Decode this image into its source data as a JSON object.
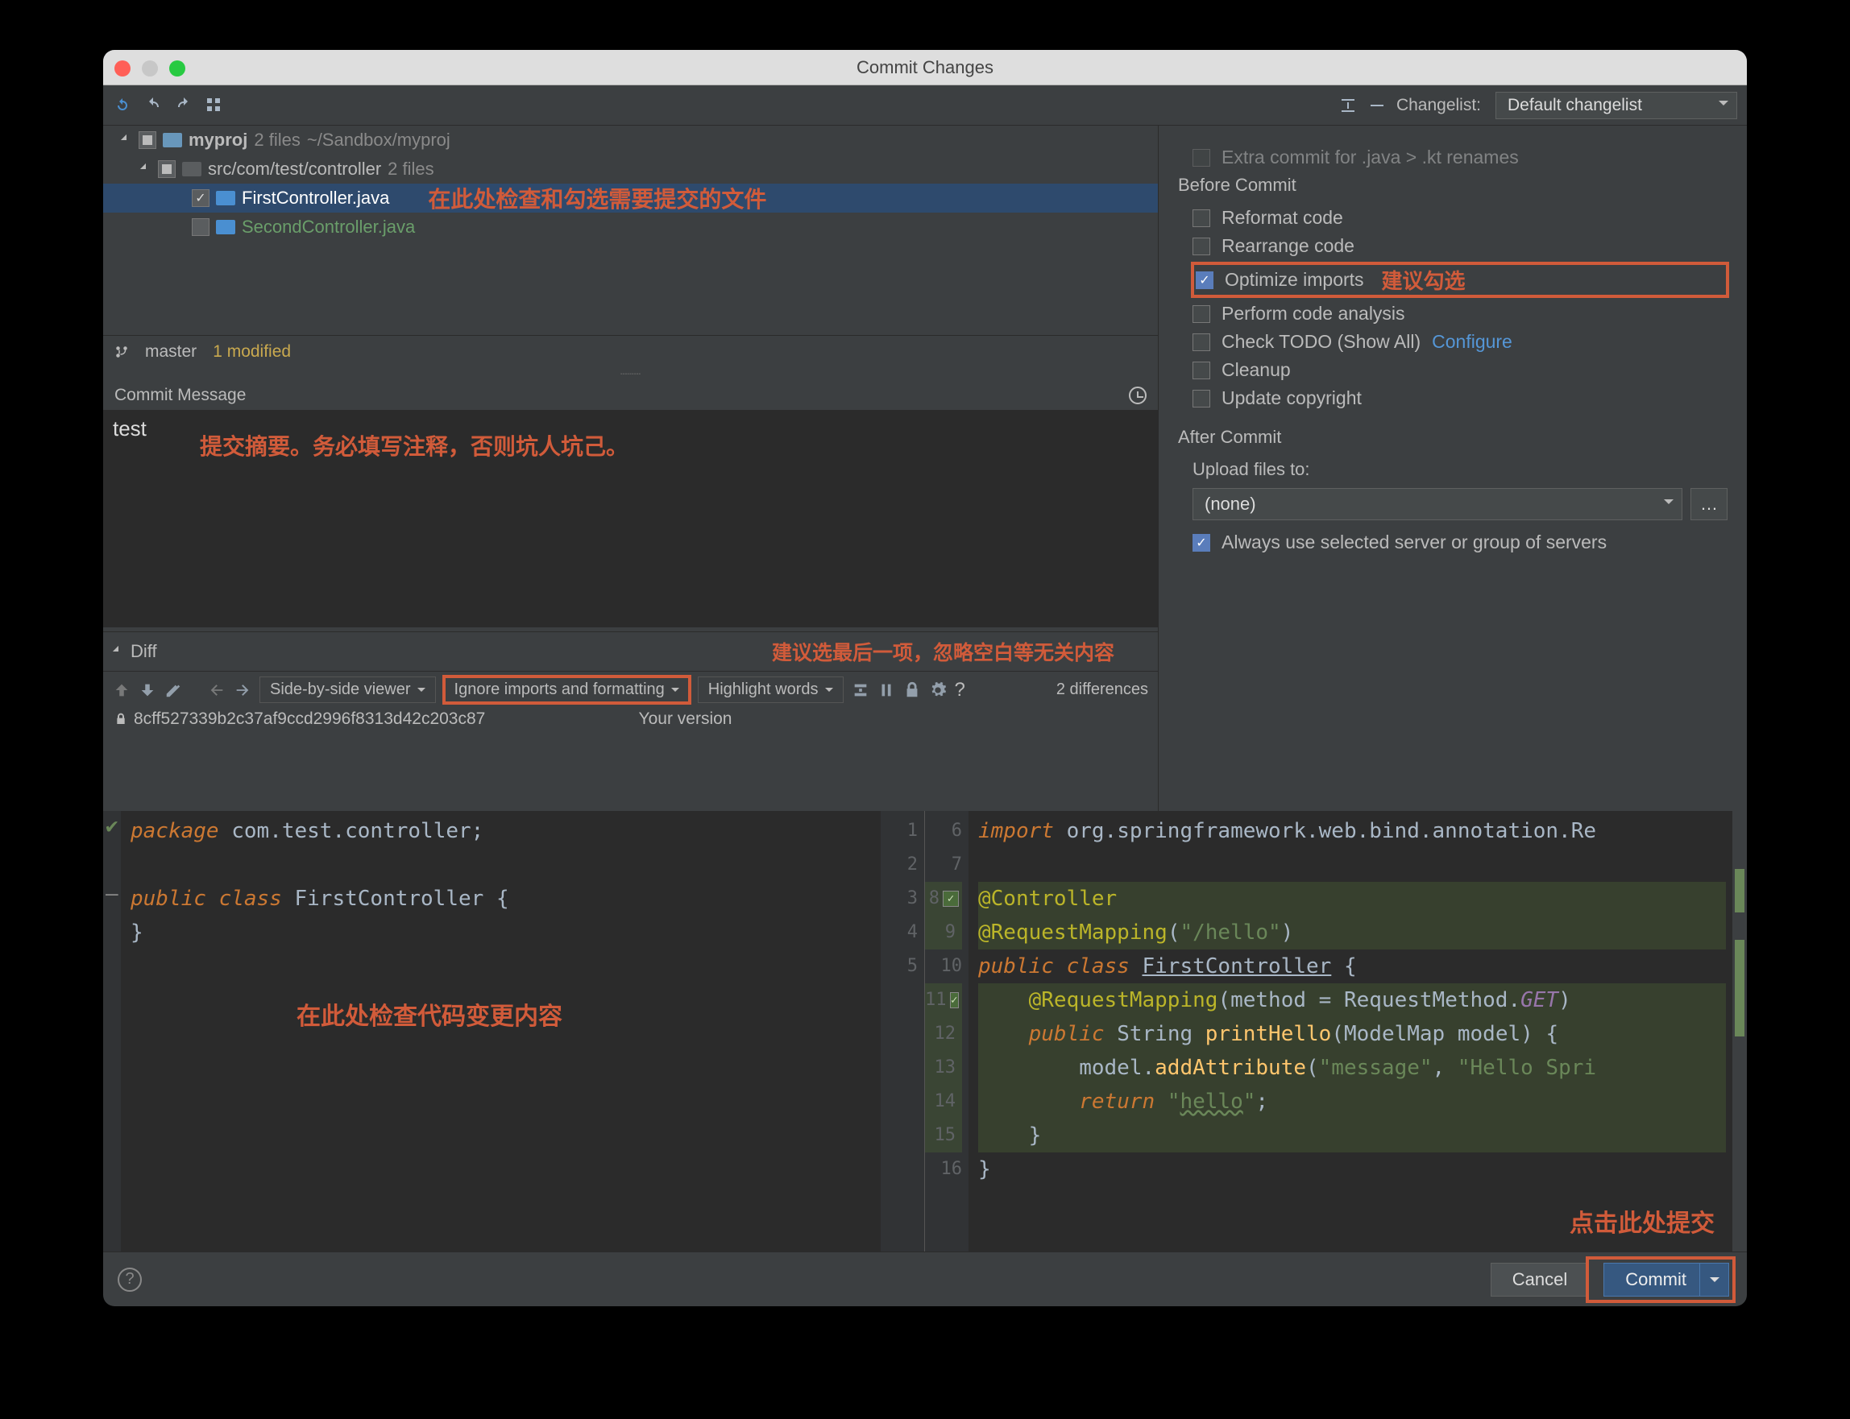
{
  "title": "Commit Changes",
  "toolbar": {
    "changelist_label": "Changelist:",
    "changelist_value": "Default changelist"
  },
  "tree": {
    "root": "myproj",
    "root_count": "2 files",
    "root_path": "~/Sandbox/myproj",
    "sub": "src/com/test/controller",
    "sub_count": "2 files",
    "file1": "FirstController.java",
    "file2": "SecondController.java",
    "annot_files": "在此处检查和勾选需要提交的文件"
  },
  "branchbar": {
    "branch": "master",
    "status": "1 modified"
  },
  "commit": {
    "label": "Commit Message",
    "value": "test",
    "annot": "提交摘要。务必填写注释，否则坑人坑己。"
  },
  "diff": {
    "label": "Diff",
    "annot_top": "建议选最后一项，忽略空白等无关内容",
    "viewer": "Side-by-side viewer",
    "ignore": "Ignore imports and formatting",
    "highlight": "Highlight words",
    "count": "2 differences",
    "rev": "8cff527339b2c37af9ccd2996f8313d42c203c87",
    "your_version": "Your version",
    "annot_left": "在此处检查代码变更内容",
    "annot_right": "点击此处提交"
  },
  "code_left": {
    "l1": "package com.test.controller;",
    "l2": "",
    "l3": "public class FirstController {",
    "l4": "}"
  },
  "code_right": {
    "l6": "import org.springframework.web.bind.annotation.Re",
    "l8": "@Controller",
    "l9a": "@RequestMapping",
    "l9b": "(\"/hello\")",
    "l10": "public class FirstController {",
    "l11a": "    @RequestMapping",
    "l11b": "(method = RequestMethod.",
    "l11c": "GET",
    "l11d": ")",
    "l12a": "    public String ",
    "l12b": "printHello",
    "l12c": "(ModelMap ",
    "l12d": "model",
    "l12e": ") {",
    "l13a": "        model.",
    "l13b": "addAttribute",
    "l13c": "(",
    "l13d": "\"message\"",
    "l13e": ", ",
    "l13f": "\"Hello Spri",
    "l14a": "        return ",
    "l14b": "\"hello\"",
    "l14c": ";",
    "l15": "    }",
    "l16": "}"
  },
  "right": {
    "before": "Before Commit",
    "c_extra": "Extra commit for .java > .kt renames",
    "c_reformat": "Reformat code",
    "c_rearrange": "Rearrange code",
    "c_optimize": "Optimize imports",
    "c_optimize_annot": "建议勾选",
    "c_analysis": "Perform code analysis",
    "c_todo": "Check TODO (Show All)",
    "c_todo_link": "Configure",
    "c_cleanup": "Cleanup",
    "c_copyright": "Update copyright",
    "after": "After Commit",
    "upload_label": "Upload files to:",
    "upload_value": "(none)",
    "upload_always": "Always use selected server or group of servers"
  },
  "bottom": {
    "cancel": "Cancel",
    "commit": "Commit"
  }
}
